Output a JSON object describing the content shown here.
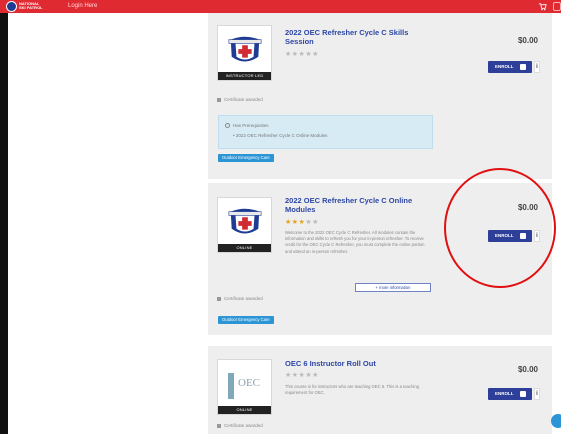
{
  "header": {
    "logo_text": "NATIONAL SKI PATROL",
    "login_label": "Login Here",
    "cart_icon": "cart-icon"
  },
  "courses": [
    {
      "title": "2022 OEC Refresher Cycle C Skills Session",
      "rating": 0,
      "thumb_label": "INSTRUCTOR LED",
      "price": "$0.00",
      "enroll_label": "ENROLL",
      "info_label": "i",
      "certificate": "Certificate awarded",
      "prereq_header": "Has Prerequisites",
      "prereq_item": "2022 OEC Refresher Cycle C Online Modules",
      "tag": "Outdoor Emergency Care"
    },
    {
      "title": "2022 OEC Refresher Cycle C Online Modules",
      "rating": 3,
      "thumb_label": "ONLINE",
      "description": "Welcome to the 2022 OEC Cycle C Refresher. All modules contain the information and skills to refresh you for your in-person refresher. To receive credit for the OEC Cycle C Refresher, you must complete the online portion and attend an in-person refresher.",
      "more_info_label": "+ more information",
      "price": "$0.00",
      "enroll_label": "ENROLL",
      "info_label": "i",
      "certificate": "Certificate awarded",
      "tag": "Outdoor Emergency Care"
    },
    {
      "title": "OEC 6 Instructor Roll Out",
      "rating": 0,
      "thumb_label": "ONLINE",
      "logo_text": "OEC",
      "description": "This course is for instructors who are teaching OEC 6. This is a teaching requirement for OEC.",
      "price": "$0.00",
      "enroll_label": "ENROLL",
      "info_label": "i",
      "certificate": "Certificate awarded"
    }
  ],
  "annotation": {
    "color": "#e01010"
  },
  "colors": {
    "topbar": "#e02a32",
    "title": "#2d47a6",
    "enroll_button": "#2d3f98",
    "tag": "#2c95d6",
    "star": "#e4a51b"
  }
}
